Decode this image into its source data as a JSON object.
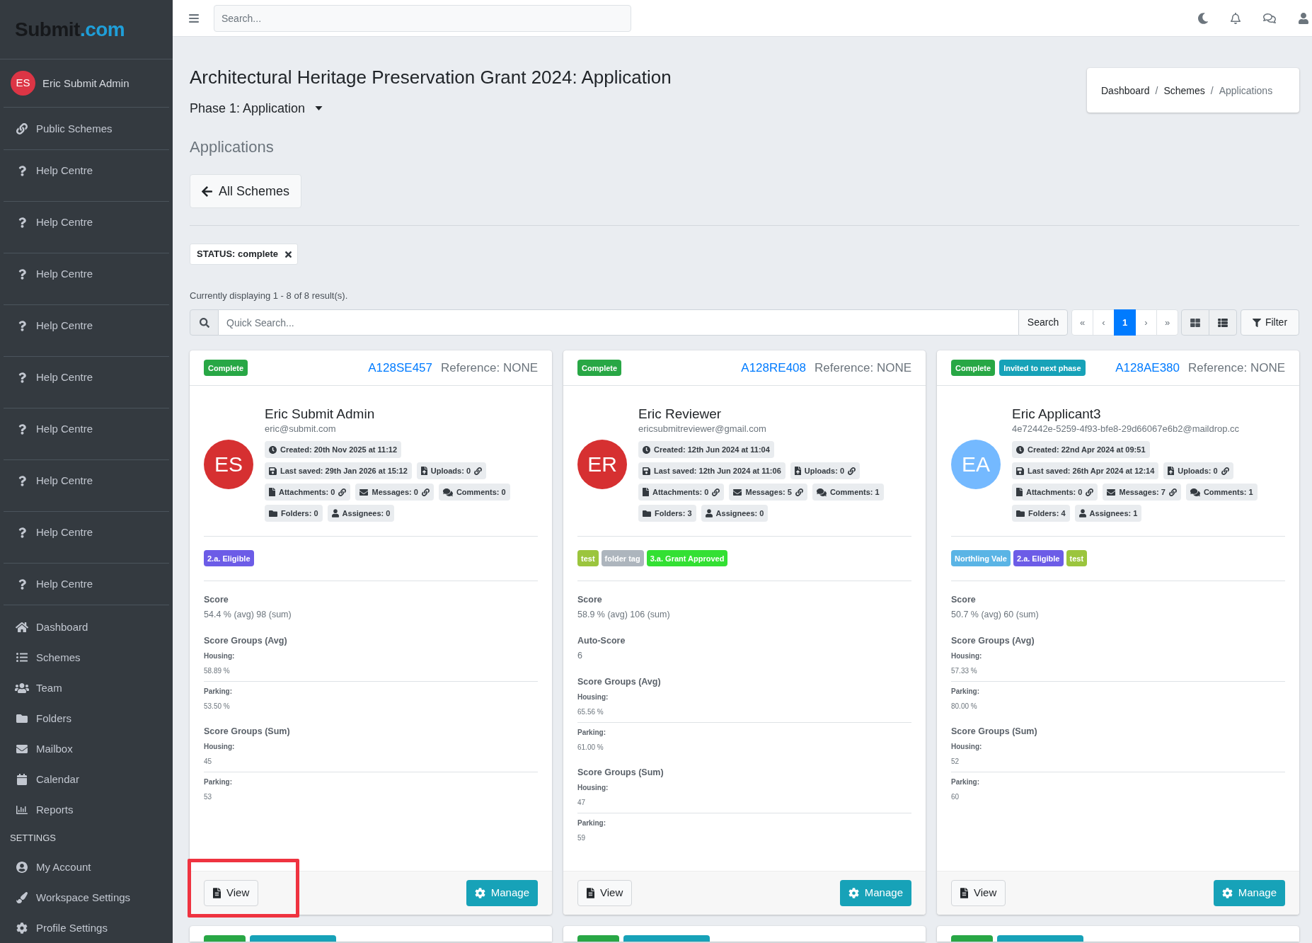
{
  "sidebar": {
    "logo": {
      "text": "Submit",
      "accent": ".com"
    },
    "user": {
      "initials": "ES",
      "name": "Eric Submit Admin"
    },
    "links": [
      {
        "kind": "link",
        "label": "Public Schemes"
      },
      {
        "kind": "help",
        "label": "Help Centre"
      },
      {
        "kind": "help",
        "label": "Help Centre"
      },
      {
        "kind": "help",
        "label": "Help Centre"
      },
      {
        "kind": "help",
        "label": "Help Centre"
      },
      {
        "kind": "help",
        "label": "Help Centre"
      },
      {
        "kind": "help",
        "label": "Help Centre"
      },
      {
        "kind": "help",
        "label": "Help Centre"
      },
      {
        "kind": "help",
        "label": "Help Centre"
      },
      {
        "kind": "help",
        "label": "Help Centre"
      }
    ],
    "nav": [
      {
        "label": "Dashboard"
      },
      {
        "label": "Schemes"
      },
      {
        "label": "Team"
      },
      {
        "label": "Folders"
      },
      {
        "label": "Mailbox"
      },
      {
        "label": "Calendar"
      },
      {
        "label": "Reports"
      }
    ],
    "settings_heading": "SETTINGS",
    "settings": [
      {
        "label": "My Account"
      },
      {
        "label": "Workspace Settings"
      },
      {
        "label": "Profile Settings"
      }
    ]
  },
  "topbar": {
    "search": {
      "placeholder": "Search..."
    }
  },
  "header": {
    "title": "Architectural Heritage Preservation Grant 2024: Application",
    "phase": "Phase 1: Application",
    "subtitle": "Applications",
    "back_button": "All Schemes",
    "breadcrumb": [
      {
        "label": "Dashboard",
        "current": false
      },
      {
        "separator": "/",
        "label": "Schemes",
        "current": false
      },
      {
        "separator": "/",
        "label": "Applications",
        "current": true
      }
    ]
  },
  "filters": [
    {
      "label": "STATUS: complete"
    }
  ],
  "results": "Currently displaying 1 - 8 of 8 result(s).",
  "toolbar": {
    "search": {
      "placeholder": "Quick Search...",
      "button": "Search"
    },
    "pages": [
      {
        "label": "«",
        "selected": false
      },
      {
        "label": "‹",
        "selected": false
      },
      {
        "label": "1",
        "selected": true
      },
      {
        "label": "›",
        "selected": false
      },
      {
        "label": "»",
        "selected": false
      }
    ],
    "filter_button": "Filter"
  },
  "cards": [
    {
      "highlighted": true,
      "badges": [
        {
          "label": "Complete",
          "color": "#28a745"
        }
      ],
      "id": "A128SE457",
      "reference": "Reference: NONE",
      "avatar": {
        "initials": "ES",
        "color": "#d63031"
      },
      "name": "Eric Submit Admin",
      "email": "eric@submit.com",
      "meta": [
        [
          {
            "kind": "created",
            "text": "Created: 20th Nov 2025 at 11:12",
            "linked": false
          }
        ],
        [
          {
            "kind": "saved",
            "text": "Last saved: 29th Jan 2026 at 15:12",
            "linked": false
          },
          {
            "kind": "uploads",
            "text": "Uploads: 0",
            "linked": true
          }
        ],
        [
          {
            "kind": "attachments",
            "text": "Attachments: 0",
            "linked": true
          },
          {
            "kind": "messages",
            "text": "Messages: 0",
            "linked": true
          },
          {
            "kind": "comments",
            "text": "Comments: 0",
            "linked": false
          }
        ],
        [
          {
            "kind": "folders",
            "text": "Folders: 0",
            "linked": false
          },
          {
            "kind": "assignees",
            "text": "Assignees: 0",
            "linked": false
          }
        ]
      ],
      "tags": [
        {
          "label": "2.a. Eligible",
          "color": "#6c5ce7"
        }
      ],
      "sections": [
        {
          "kind": "value",
          "heading": "Score",
          "value": "54.4 % (avg) 98 (sum)"
        },
        {
          "kind": "groups",
          "heading": "Score Groups (Avg)",
          "items": [
            {
              "label": "Housing:",
              "value": "58.89 %"
            },
            {
              "label": "Parking:",
              "value": "53.50 %"
            }
          ]
        },
        {
          "kind": "groups",
          "heading": "Score Groups (Sum)",
          "items": [
            {
              "label": "Housing:",
              "value": "45"
            },
            {
              "label": "Parking:",
              "value": "53"
            }
          ]
        }
      ],
      "actions": {
        "view": "View",
        "manage": "Manage"
      }
    },
    {
      "highlighted": false,
      "badges": [
        {
          "label": "Complete",
          "color": "#28a745"
        }
      ],
      "id": "A128RE408",
      "reference": "Reference: NONE",
      "avatar": {
        "initials": "ER",
        "color": "#d63031"
      },
      "name": "Eric Reviewer",
      "email": "ericsubmitreviewer@gmail.com",
      "meta": [
        [
          {
            "kind": "created",
            "text": "Created: 12th Jun 2024 at 11:04",
            "linked": false
          }
        ],
        [
          {
            "kind": "saved",
            "text": "Last saved: 12th Jun 2024 at 11:06",
            "linked": false
          },
          {
            "kind": "uploads",
            "text": "Uploads: 0",
            "linked": true
          }
        ],
        [
          {
            "kind": "attachments",
            "text": "Attachments: 0",
            "linked": true
          },
          {
            "kind": "messages",
            "text": "Messages: 5",
            "linked": true
          },
          {
            "kind": "comments",
            "text": "Comments: 1",
            "linked": false
          }
        ],
        [
          {
            "kind": "folders",
            "text": "Folders: 3",
            "linked": false
          },
          {
            "kind": "assignees",
            "text": "Assignees: 0",
            "linked": false
          }
        ]
      ],
      "tags": [
        {
          "label": "test",
          "color": "#9bc53d"
        },
        {
          "label": "folder tag",
          "color": "#adb5bd"
        },
        {
          "label": "3.a. Grant Approved",
          "color": "#33e033"
        }
      ],
      "sections": [
        {
          "kind": "value",
          "heading": "Score",
          "value": "58.9 % (avg) 106 (sum)"
        },
        {
          "kind": "value",
          "heading": "Auto-Score",
          "value": "6"
        },
        {
          "kind": "groups",
          "heading": "Score Groups (Avg)",
          "items": [
            {
              "label": "Housing:",
              "value": "65.56 %"
            },
            {
              "label": "Parking:",
              "value": "61.00 %"
            }
          ]
        },
        {
          "kind": "groups",
          "heading": "Score Groups (Sum)",
          "items": [
            {
              "label": "Housing:",
              "value": "47"
            },
            {
              "label": "Parking:",
              "value": "59"
            }
          ]
        }
      ],
      "actions": {
        "view": "View",
        "manage": "Manage"
      }
    },
    {
      "highlighted": false,
      "badges": [
        {
          "label": "Complete",
          "color": "#28a745"
        },
        {
          "label": "Invited to next phase",
          "color": "#17a2b8"
        }
      ],
      "id": "A128AE380",
      "reference": "Reference: NONE",
      "avatar": {
        "initials": "EA",
        "color": "#74b9ff"
      },
      "name": "Eric Applicant3",
      "email": "4e72442e-5259-4f93-bfe8-29d66067e6b2@maildrop.cc",
      "meta": [
        [
          {
            "kind": "created",
            "text": "Created: 22nd Apr 2024 at 09:51",
            "linked": false
          }
        ],
        [
          {
            "kind": "saved",
            "text": "Last saved: 26th Apr 2024 at 12:14",
            "linked": false
          },
          {
            "kind": "uploads",
            "text": "Uploads: 0",
            "linked": true
          }
        ],
        [
          {
            "kind": "attachments",
            "text": "Attachments: 0",
            "linked": true
          },
          {
            "kind": "messages",
            "text": "Messages: 7",
            "linked": true
          },
          {
            "kind": "comments",
            "text": "Comments: 1",
            "linked": false
          }
        ],
        [
          {
            "kind": "folders",
            "text": "Folders: 4",
            "linked": false
          },
          {
            "kind": "assignees",
            "text": "Assignees: 1",
            "linked": false
          }
        ]
      ],
      "tags": [
        {
          "label": "Northling Vale",
          "color": "#5ab4e5"
        },
        {
          "label": "2.a. Eligible",
          "color": "#6c5ce7"
        },
        {
          "label": "test",
          "color": "#9bc53d"
        }
      ],
      "sections": [
        {
          "kind": "value",
          "heading": "Score",
          "value": "50.7 % (avg) 60 (sum)"
        },
        {
          "kind": "groups",
          "heading": "Score Groups (Avg)",
          "items": [
            {
              "label": "Housing:",
              "value": "57.33 %"
            },
            {
              "label": "Parking:",
              "value": "80.00 %"
            }
          ]
        },
        {
          "kind": "groups",
          "heading": "Score Groups (Sum)",
          "items": [
            {
              "label": "Housing:",
              "value": "52"
            },
            {
              "label": "Parking:",
              "value": "60"
            }
          ]
        }
      ],
      "actions": {
        "view": "View",
        "manage": "Manage"
      }
    }
  ],
  "more_cards": [
    {
      "badges": [
        {
          "color": "#28a745"
        },
        {
          "color": "#17a2b8"
        }
      ]
    },
    {
      "badges": [
        {
          "color": "#28a745"
        },
        {
          "color": "#17a2b8"
        }
      ]
    },
    {
      "badges": [
        {
          "color": "#28a745"
        },
        {
          "color": "#17a2b8"
        }
      ]
    }
  ]
}
